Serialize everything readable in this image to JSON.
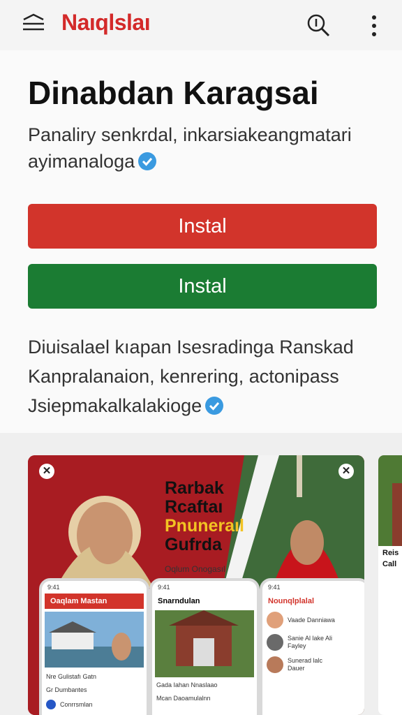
{
  "app": {
    "brand": "Naıqlslaı"
  },
  "header": {
    "title": "Dinabdan Karagsai"
  },
  "subtitle": {
    "line1": "Panaliry senkrdal, inkarsiakeangmatari",
    "line2": "ayimanaloga"
  },
  "buttons": {
    "primary_label": "Instal",
    "secondary_label": "Instal"
  },
  "description": {
    "line1": "Diuisalael kıapan Isesradinga Ranskad",
    "line2": "Kanpralanaion, kenrering, actonipass",
    "line3": "Jsiepmakalkalakioge"
  },
  "promo": {
    "line1": "Rarbak",
    "line2": "Rcaftaı",
    "line3": "Pnuneraıl",
    "line4": "Gufrda",
    "tagline": "Oqlum Onogasıl"
  },
  "phone1": {
    "time": "9:41",
    "header": "Oaqlam Mastan",
    "caption": "Nre Gulistafı Gatn",
    "caption2": "Gr Dumbantes",
    "row": "Conrrsmlan"
  },
  "phone2": {
    "time": "9:41",
    "header": "Snarndulan",
    "caption": "Gada Iahan Nnaslaao",
    "caption2": "Mcan Daoamulalnn"
  },
  "phone3": {
    "time": "9:41",
    "header": "Nounqlplalal",
    "row1": "Vaade Danniawa",
    "row2a": "Sanie Al lake Ali",
    "row2b": "Fayley",
    "row3a": "Sunerad lalc",
    "row3b": "Dauer"
  },
  "shot2": {
    "label1": "Reis",
    "label2": "Call"
  },
  "colors": {
    "brand": "#d32a2a",
    "primary": "#d2342b",
    "secondary": "#1b7c33",
    "verified": "#3a9ae0"
  },
  "icons": {
    "menu": "menu-icon",
    "search": "search-icon",
    "more": "more-vertical-icon",
    "verified": "verified-badge-icon",
    "close": "close-icon"
  }
}
